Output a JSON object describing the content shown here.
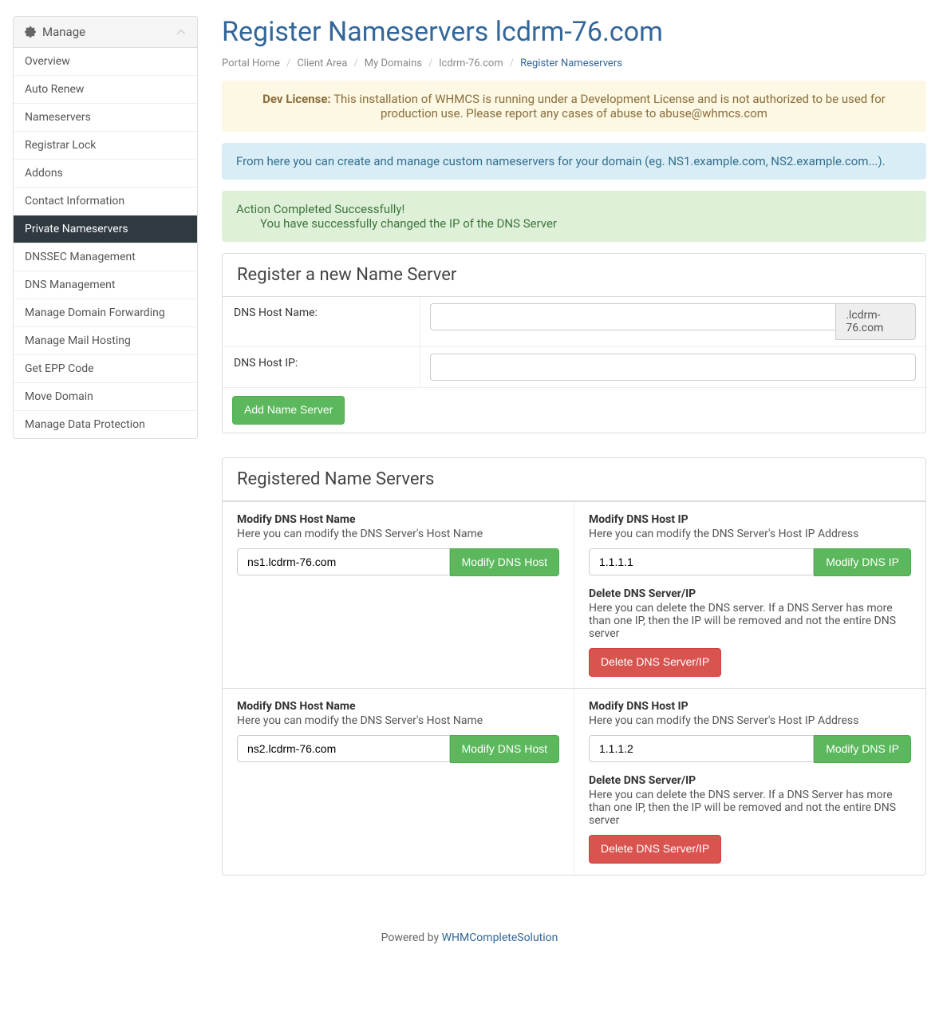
{
  "sidebar": {
    "header": "Manage",
    "items": [
      {
        "label": "Overview",
        "active": false
      },
      {
        "label": "Auto Renew",
        "active": false
      },
      {
        "label": "Nameservers",
        "active": false
      },
      {
        "label": "Registrar Lock",
        "active": false
      },
      {
        "label": "Addons",
        "active": false
      },
      {
        "label": "Contact Information",
        "active": false
      },
      {
        "label": "Private Nameservers",
        "active": true
      },
      {
        "label": "DNSSEC Management",
        "active": false
      },
      {
        "label": "DNS Management",
        "active": false
      },
      {
        "label": "Manage Domain Forwarding",
        "active": false
      },
      {
        "label": "Manage Mail Hosting",
        "active": false
      },
      {
        "label": "Get EPP Code",
        "active": false
      },
      {
        "label": "Move Domain",
        "active": false
      },
      {
        "label": "Manage Data Protection",
        "active": false
      }
    ]
  },
  "page": {
    "title": "Register Nameservers lcdrm-76.com",
    "breadcrumb": [
      {
        "label": "Portal Home",
        "link": true
      },
      {
        "label": "Client Area",
        "link": true
      },
      {
        "label": "My Domains",
        "link": true
      },
      {
        "label": "lcdrm-76.com",
        "link": true
      },
      {
        "label": "Register Nameservers",
        "link": false
      }
    ]
  },
  "alerts": {
    "dev_license_label": "Dev License:",
    "dev_license_text": " This installation of WHMCS is running under a Development License and is not authorized to be used for production use. Please report any cases of abuse to abuse@whmcs.com",
    "info_text": "From here you can create and manage custom nameservers for your domain (eg. NS1.example.com, NS2.example.com...).",
    "success_title": "Action Completed Successfully!",
    "success_body": "You have successfully changed the IP of the DNS Server"
  },
  "register": {
    "panel_title": "Register a new Name Server",
    "hostname_label": "DNS Host Name:",
    "hostname_value": "",
    "hostname_suffix": ".lcdrm-76.com",
    "ip_label": "DNS Host IP:",
    "ip_value": "",
    "submit_label": "Add Name Server"
  },
  "registered": {
    "panel_title": "Registered Name Servers",
    "modify_host_title": "Modify DNS Host Name",
    "modify_host_desc": "Here you can modify the DNS Server's Host Name",
    "modify_host_btn": "Modify DNS Host",
    "modify_ip_title": "Modify DNS Host IP",
    "modify_ip_desc": "Here you can modify the DNS Server's Host IP Address",
    "modify_ip_btn": "Modify DNS IP",
    "delete_title": "Delete DNS Server/IP",
    "delete_desc": "Here you can delete the DNS server. If a DNS Server has more than one IP, then the IP will be removed and not the entire DNS server",
    "delete_btn": "Delete DNS Server/IP",
    "servers": [
      {
        "host": "ns1.lcdrm-76.com",
        "ip": "1.1.1.1"
      },
      {
        "host": "ns2.lcdrm-76.com",
        "ip": "1.1.1.2"
      }
    ]
  },
  "footer": {
    "prefix": "Powered by ",
    "link": "WHMCompleteSolution"
  }
}
